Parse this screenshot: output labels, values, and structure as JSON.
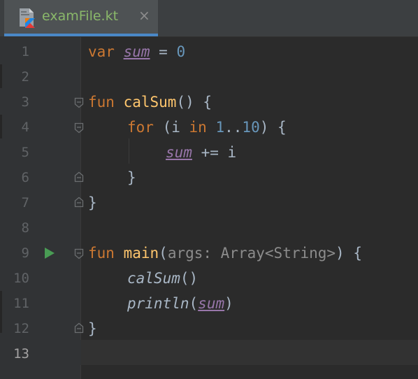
{
  "tab": {
    "title": "examFile.kt",
    "close": "×"
  },
  "editor": {
    "current_line": 13,
    "lines": [
      {
        "n": "1"
      },
      {
        "n": "2"
      },
      {
        "n": "3"
      },
      {
        "n": "4"
      },
      {
        "n": "5"
      },
      {
        "n": "6"
      },
      {
        "n": "7"
      },
      {
        "n": "8"
      },
      {
        "n": "9"
      },
      {
        "n": "10"
      },
      {
        "n": "11"
      },
      {
        "n": "12"
      },
      {
        "n": "13"
      }
    ],
    "code": {
      "l1": {
        "kw": "var",
        "v": "sum",
        "op": " = ",
        "num": "0"
      },
      "l3": {
        "kw": "fun",
        "fn": "calSum",
        "rest": "() {"
      },
      "l4": {
        "kw": "for",
        "p1": " (i ",
        "kw2": "in",
        "n1": "1",
        "dots": "..",
        "n2": "10",
        "rest": ") {"
      },
      "l5": {
        "v": "sum",
        "rest": " += i"
      },
      "l6": {
        "rest": "}"
      },
      "l7": {
        "rest": "}"
      },
      "l9": {
        "kw": "fun",
        "fn": "main",
        "p1": "(",
        "param": "args: Array<String>",
        "rest": ") {"
      },
      "l10": {
        "it": "calSum",
        "rest": "()"
      },
      "l11": {
        "it": "println",
        "p1": "(",
        "v": "sum",
        "rest": ")"
      },
      "l12": {
        "rest": "}"
      }
    }
  },
  "colors": {
    "keyword": "#cc7832",
    "function": "#ffc66d",
    "variable": "#9876aa",
    "number": "#6897bb",
    "text": "#a9b7c6",
    "tab_title": "#8ab86a",
    "run_icon": "#499c54",
    "accent": "#4a88c7"
  }
}
